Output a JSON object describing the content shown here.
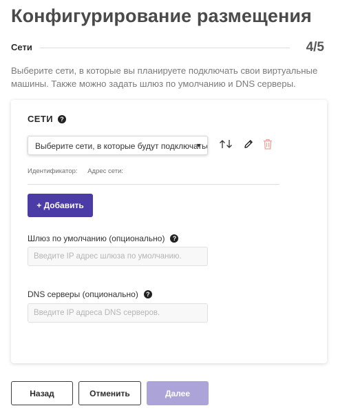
{
  "page": {
    "title": "Конфигурирование размещения",
    "step_label": "Сети",
    "step_count": "4/5",
    "subtitle": "Выберите сети, в которые вы планируете подключать свои виртуальные машины. Также можно задать шлюз по умолчанию и DNS серверы."
  },
  "networks": {
    "section_title": "СЕТИ",
    "help_glyph": "?",
    "select_value": "Выберите сети, в которые будут подключаться",
    "select_arrow": "▼",
    "identifier_label": "Идентификатор:",
    "address_label": "Адрес сети:",
    "add_button_label": "+ Добавить",
    "icons": [
      "sort-icon",
      "edit-icon",
      "delete-icon"
    ]
  },
  "gateway": {
    "label": "Шлюз по умолчанию (опционально)",
    "value": "",
    "placeholder": "Введите IP адрес шлюза по умолчанию."
  },
  "dns": {
    "label": "DNS серверы (опционально)",
    "value": "",
    "placeholder": "Введите IP адреса DNS серверов."
  },
  "footer": {
    "back_label": "Назад",
    "cancel_label": "Отменить",
    "next_label": "Далее"
  },
  "colors": {
    "accent": "#4b3ba6",
    "accent_disabled": "#aca4d9",
    "delete_icon": "#e8a39a"
  }
}
